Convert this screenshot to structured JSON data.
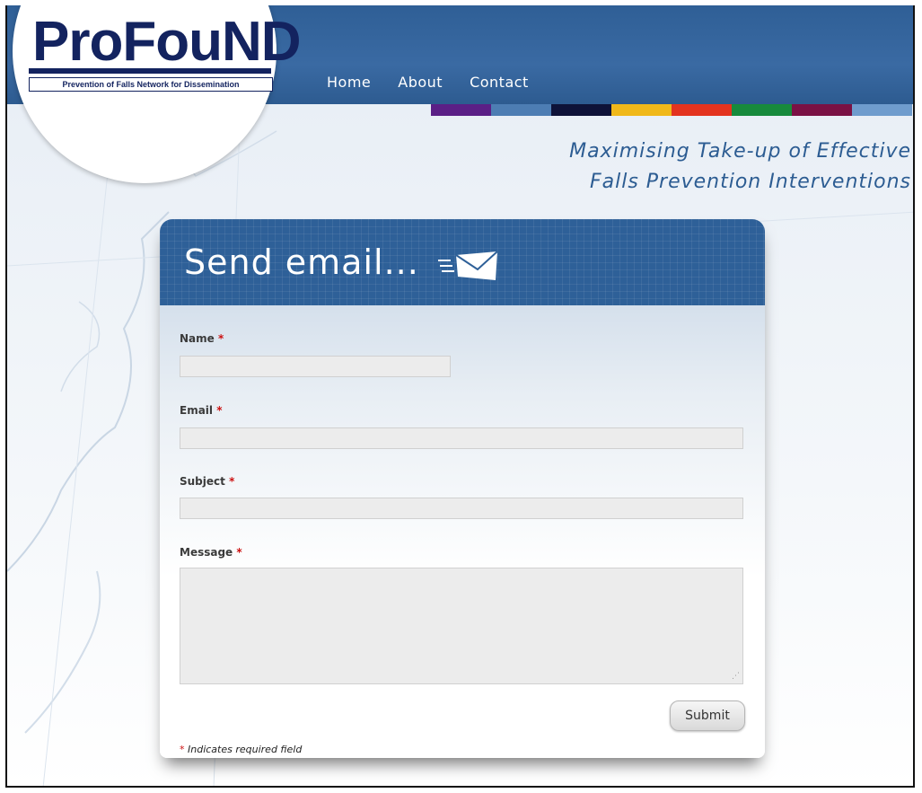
{
  "logo": {
    "name": "ProFouND",
    "tagline": "Prevention of Falls Network for Dissemination"
  },
  "nav": {
    "items": [
      "Home",
      "About",
      "Contact"
    ]
  },
  "colorbar": [
    "#5b1f86",
    "#4d7db3",
    "#0e1238",
    "#f0b81a",
    "#e3331f",
    "#178a3c",
    "#7a1144",
    "#6f9ccd"
  ],
  "tagline": {
    "line1": "Maximising Take-up of Effective",
    "line2": "Falls Prevention Interventions"
  },
  "form": {
    "title": "Send email...",
    "name_label": "Name",
    "email_label": "Email",
    "subject_label": "Subject",
    "message_label": "Message",
    "required_mark": "*",
    "name_value": "",
    "email_value": "",
    "subject_value": "",
    "message_value": "",
    "submit_label": "Submit",
    "note_mark": "*",
    "note_text": "Indicates required field"
  },
  "colors": {
    "header_blue": "#2f5f96",
    "text_blue": "#2c5c92",
    "required_red": "#cc1111"
  }
}
